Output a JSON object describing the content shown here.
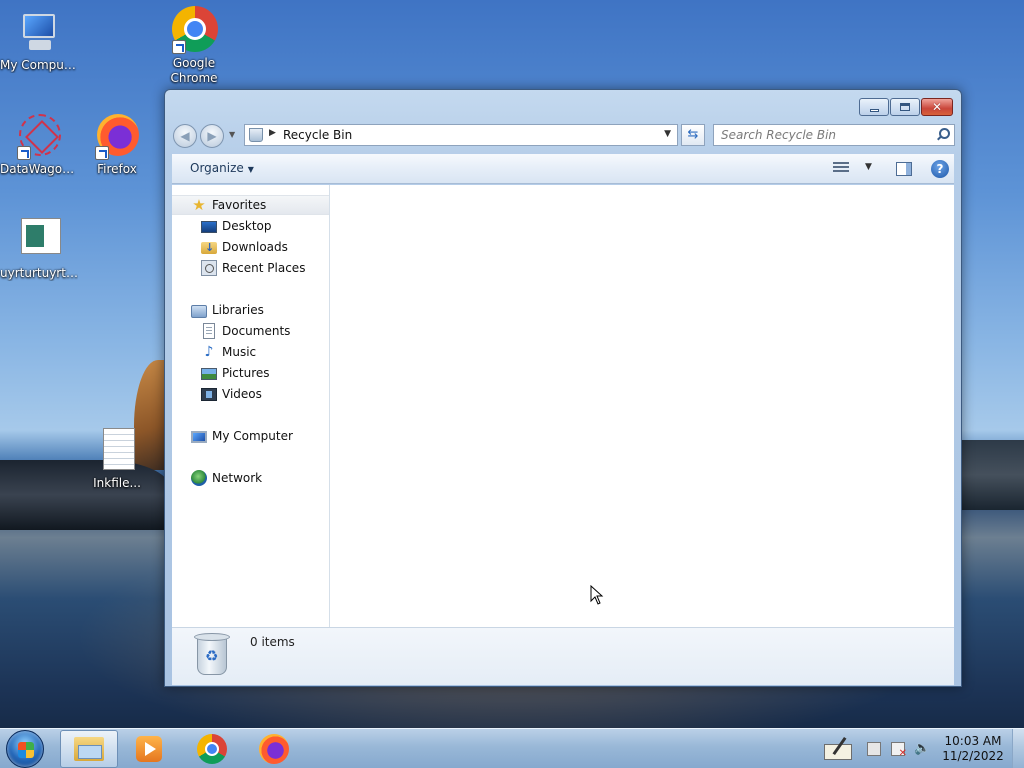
{
  "desktop": {
    "icons": {
      "my_computer": "My Computer",
      "chrome": "Google Chrome",
      "datawagon": "DataWagon...",
      "firefox": "Firefox",
      "doc": "uyrturtuyrty...",
      "inkfile": "Inkfile..."
    }
  },
  "window": {
    "address": {
      "location": "Recycle Bin"
    },
    "search": {
      "placeholder": "Search Recycle Bin"
    },
    "toolbar": {
      "organize_label": "Organize"
    },
    "navpane": {
      "favorites": "Favorites",
      "favorites_items": [
        "Desktop",
        "Downloads",
        "Recent Places"
      ],
      "libraries": "Libraries",
      "libraries_items": [
        "Documents",
        "Music",
        "Pictures",
        "Videos"
      ],
      "computer": "My Computer",
      "network": "Network"
    },
    "details": {
      "items_count": "0 items"
    }
  },
  "taskbar": {
    "clock": {
      "time": "10:03 AM",
      "date": "11/2/2022"
    },
    "apps": [
      "windows-explorer",
      "windows-media-player",
      "google-chrome",
      "firefox"
    ]
  },
  "colors": {
    "window_frame": "#b5cde8",
    "taskbar": "#a4c4e4",
    "close_button": "#c9463a"
  }
}
